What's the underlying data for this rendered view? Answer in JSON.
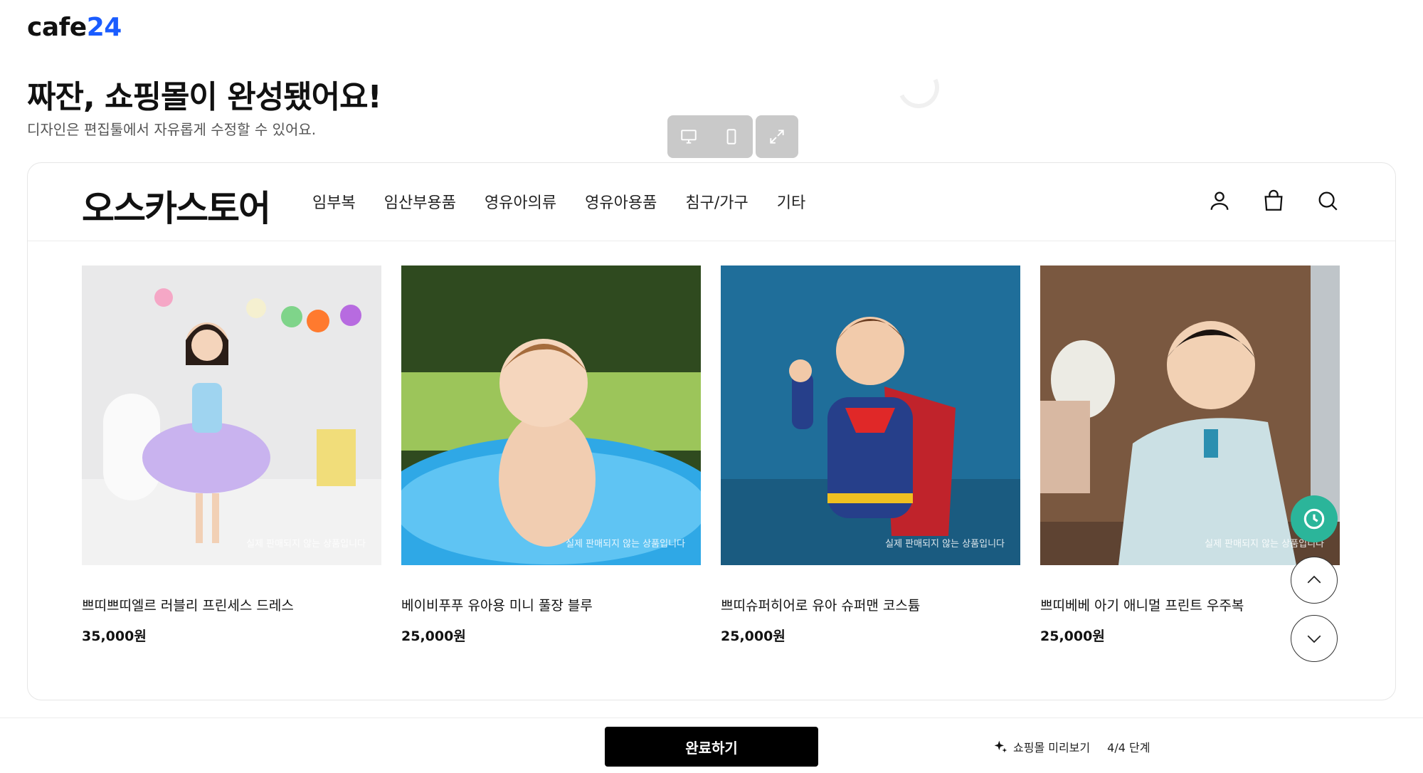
{
  "app": {
    "logo_text": "cafe",
    "logo_accent": "24"
  },
  "intro": {
    "headline": "짜잔, 쇼핑몰이 완성됐어요!",
    "subline": "디자인은 편집툴에서 자유롭게 수정할 수 있어요."
  },
  "view_toggle": {
    "desktop_icon": "monitor-icon",
    "mobile_icon": "smartphone-icon",
    "expand_icon": "expand-icon"
  },
  "store": {
    "name": "오스카스토어",
    "nav": [
      "임부복",
      "임산부용품",
      "영유아의류",
      "영유아용품",
      "침구/가구",
      "기타"
    ],
    "icons": [
      "user-icon",
      "shopping-bag-icon",
      "search-icon"
    ]
  },
  "products": [
    {
      "name": "쁘띠쁘띠엘르 러블리 프린세스 드레스",
      "price": "35,000원",
      "notice": "실제 판매되지 않는 상품입니다"
    },
    {
      "name": "베이비푸푸 유아용 미니 풀장 블루",
      "price": "25,000원",
      "notice": "실제 판매되지 않는 상품입니다"
    },
    {
      "name": "쁘띠슈퍼히어로 유아 슈퍼맨 코스튬",
      "price": "25,000원",
      "notice": "실제 판매되지 않는 상품입니다"
    },
    {
      "name": "쁘띠베베 아기 애니멀 프린트 우주복",
      "price": "25,000원",
      "notice": "실제 판매되지 않는 상품입니다"
    }
  ],
  "floating": {
    "history_icon": "clock-icon",
    "up_icon": "chevron-up-icon",
    "down_icon": "chevron-down-icon"
  },
  "footer": {
    "done_label": "완료하기",
    "step_label": "쇼핑몰 미리보기",
    "step_progress": "4/4 단계",
    "step_icon": "sparkle-icon"
  },
  "colors": {
    "brand_accent": "#1a5cff",
    "primary_button": "#000000",
    "history_button": "#2bb59a"
  }
}
